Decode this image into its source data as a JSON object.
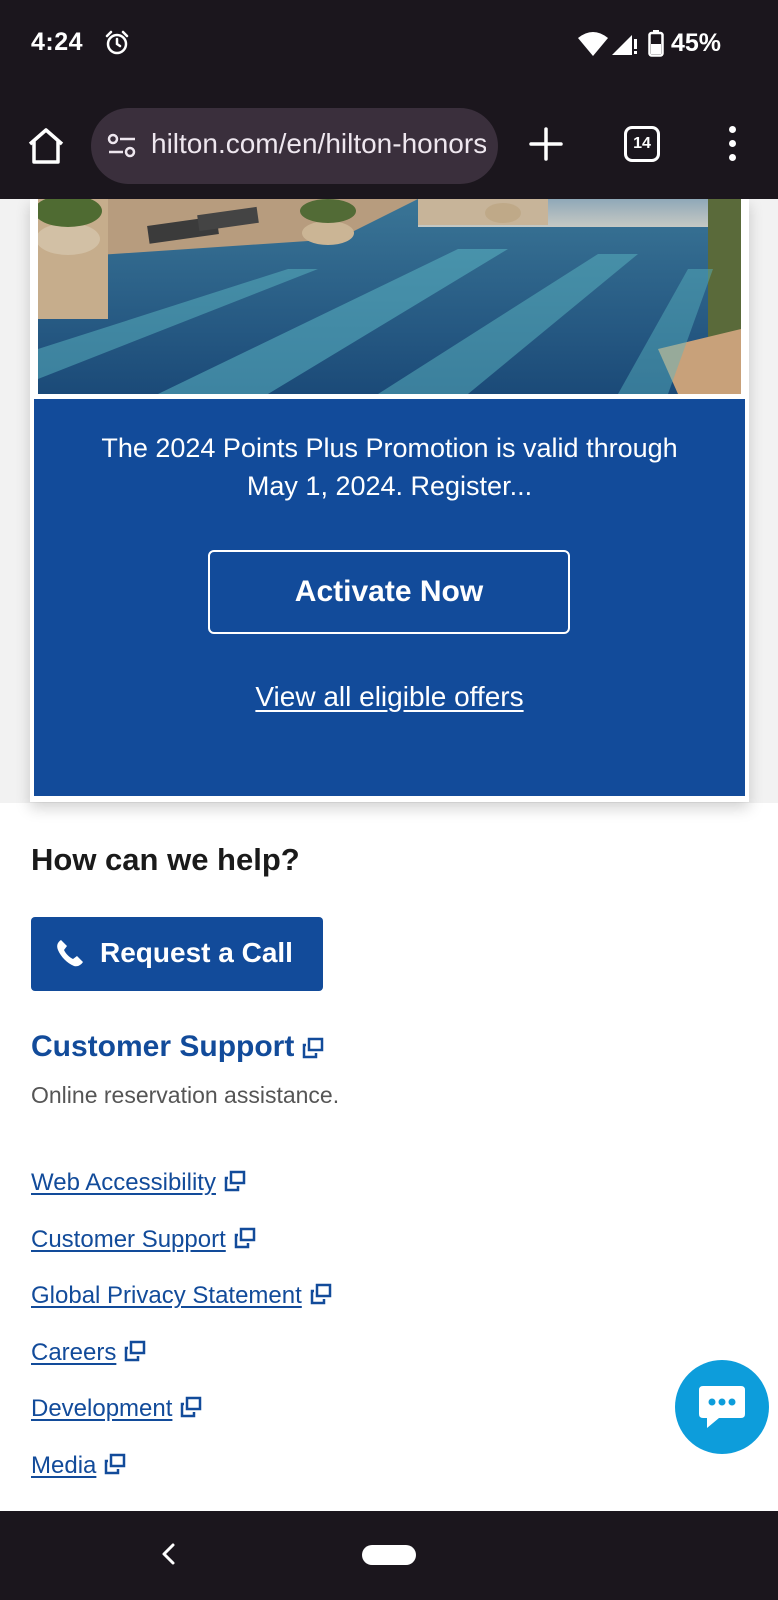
{
  "status_bar": {
    "time": "4:24",
    "battery_percent": "45%"
  },
  "browser": {
    "url": "hilton.com/en/hilton-honors",
    "tab_count": "14"
  },
  "promo": {
    "text": "The 2024 Points Plus Promotion is valid through May 1, 2024. Register...",
    "activate_label": "Activate Now",
    "view_offers_label": "View all eligible offers"
  },
  "help": {
    "heading": "How can we help?",
    "call_label": "Request a Call",
    "support_title": "Customer Support",
    "support_desc": "Online reservation assistance."
  },
  "footer_links": [
    {
      "label": "Web Accessibility"
    },
    {
      "label": "Customer Support"
    },
    {
      "label": "Global Privacy Statement"
    },
    {
      "label": "Careers"
    },
    {
      "label": "Development"
    },
    {
      "label": "Media"
    }
  ],
  "colors": {
    "brand_blue": "#124b9a",
    "chat_blue": "#0d9ddb",
    "system_bar": "#1b161d"
  }
}
